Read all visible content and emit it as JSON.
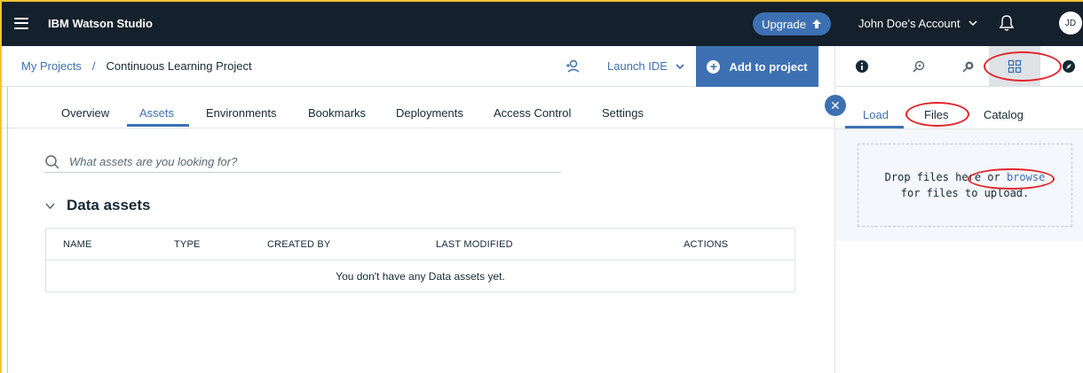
{
  "app": {
    "title": "IBM Watson Studio"
  },
  "topbar": {
    "upgrade_label": "Upgrade",
    "account_label": "John Doe's Account",
    "avatar_initials": "JD"
  },
  "breadcrumb": {
    "root": "My Projects",
    "separator": "/",
    "current": "Continuous Learning Project"
  },
  "actions": {
    "launch_ide": "Launch IDE",
    "add_to_project": "Add to project"
  },
  "tabs": [
    {
      "label": "Overview"
    },
    {
      "label": "Assets"
    },
    {
      "label": "Environments"
    },
    {
      "label": "Bookmarks"
    },
    {
      "label": "Deployments"
    },
    {
      "label": "Access Control"
    },
    {
      "label": "Settings"
    }
  ],
  "active_tab": "Assets",
  "search": {
    "placeholder": "What assets are you looking for?"
  },
  "data_assets": {
    "title": "Data assets",
    "columns": [
      "NAME",
      "TYPE",
      "CREATED BY",
      "LAST MODIFIED",
      "ACTIONS"
    ],
    "empty_message": "You don't have any Data assets yet."
  },
  "panel": {
    "icons": [
      "info-icon",
      "find-data-icon",
      "data-refinery-icon",
      "data-icon",
      "compass-icon"
    ],
    "active_icon": "data-icon",
    "tabs": [
      {
        "label": "Load"
      },
      {
        "label": "Files"
      },
      {
        "label": "Catalog"
      }
    ],
    "active_tab": "Load",
    "dropzone": {
      "text_before": "Drop files here or",
      "link": "browse",
      "text_after": "for files to upload."
    }
  },
  "colors": {
    "topbar": "#14202b",
    "accent": "#3d70b2",
    "annotation": "#e3242b",
    "frame": "#f4c430"
  }
}
